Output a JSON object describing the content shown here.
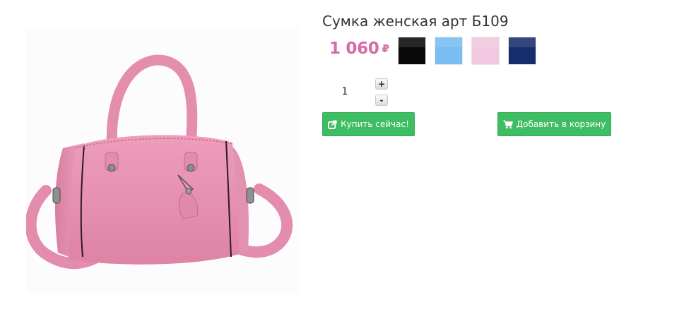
{
  "product": {
    "title": "Сумка женская арт Б109",
    "price": "1 060",
    "currency": "₽"
  },
  "swatches": [
    {
      "name": "black",
      "color": "#0a0a0a"
    },
    {
      "name": "light-blue",
      "color": "#79bdf2"
    },
    {
      "name": "light-pink",
      "color": "#f1c8e0"
    },
    {
      "name": "navy",
      "color": "#172d6b"
    }
  ],
  "quantity": {
    "value": "1",
    "plus_label": "+",
    "minus_label": "-"
  },
  "buttons": {
    "buy_now": {
      "label": "Купить сейчас!",
      "icon": "external-link-icon"
    },
    "add_to_cart": {
      "label": "Добавить в корзину",
      "icon": "shopping-cart-icon"
    }
  },
  "colors": {
    "price": "#d56ba9",
    "button": "#3fbd62",
    "bag": "#e58fae"
  }
}
